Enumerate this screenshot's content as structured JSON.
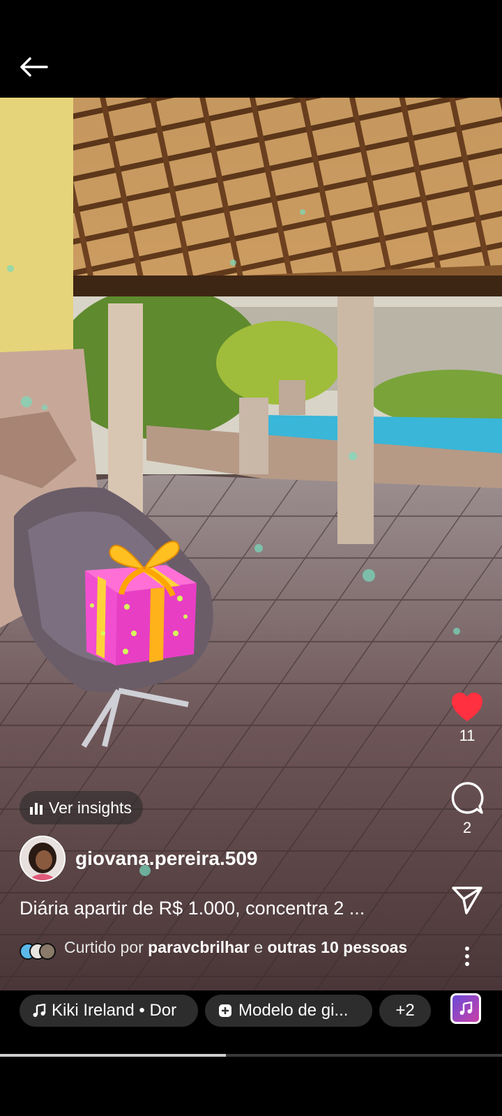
{
  "header": {
    "back_icon": "arrow-left-icon"
  },
  "post": {
    "insights_label": "Ver insights",
    "username": "giovana.pereira.509",
    "caption": "Diária apartir de R$ 1.000, concentra 2 ...",
    "liked_by": {
      "prefix": "Curtido por",
      "user": "paravcbrilhar",
      "connector": "e",
      "others": "outras 10 pessoas"
    },
    "sticker_icon": "gift-box-icon"
  },
  "actions": {
    "like": {
      "icon": "heart-icon",
      "count": "11",
      "color": "#ff3040",
      "liked": true
    },
    "comment": {
      "icon": "comment-bubble-icon",
      "count": "2"
    },
    "share": {
      "icon": "paper-plane-icon"
    },
    "more": {
      "icon": "more-vertical-icon"
    }
  },
  "bottom_chips": {
    "music": {
      "icon": "music-note-icon",
      "label": "Kiki Ireland • Dor"
    },
    "template": {
      "icon": "template-icon",
      "label": "Modelo de gi..."
    },
    "more": {
      "label": "+2"
    }
  },
  "playback": {
    "progress": 0.45
  }
}
